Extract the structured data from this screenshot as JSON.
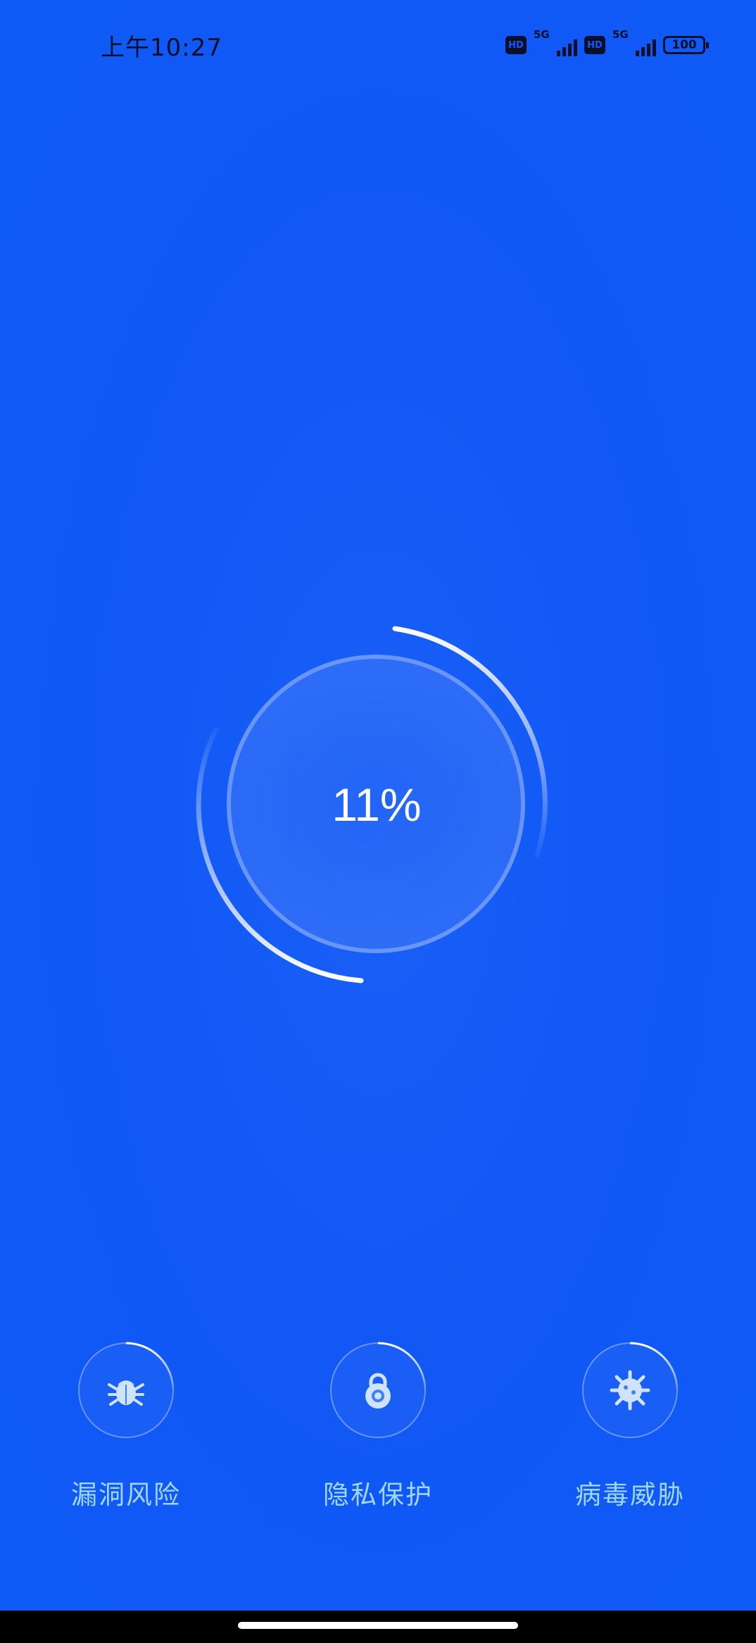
{
  "status_bar": {
    "time": "上午10:27",
    "hd_label": "HD",
    "network": "5G",
    "battery": "100"
  },
  "scanner": {
    "percent_text": "11%",
    "progress": 0.11
  },
  "features": [
    {
      "label": "漏洞风险",
      "icon": "bug-icon"
    },
    {
      "label": "隐私保护",
      "icon": "lock-icon"
    },
    {
      "label": "病毒威胁",
      "icon": "virus-icon"
    }
  ],
  "colors": {
    "background": "#1158F5",
    "label": "#9fd6ff",
    "ring": "#ffffff"
  }
}
